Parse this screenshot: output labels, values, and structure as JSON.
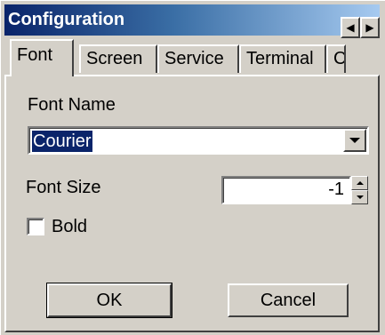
{
  "window": {
    "title": "Configuration"
  },
  "tabs": [
    {
      "label": "Font",
      "active": true
    },
    {
      "label": "Screen",
      "active": false
    },
    {
      "label": "Service",
      "active": false
    },
    {
      "label": "Terminal",
      "active": false
    },
    {
      "label": "C",
      "active": false
    }
  ],
  "tab_scroll": {
    "left_icon": "arrow-left-icon",
    "right_icon": "arrow-right-icon"
  },
  "font_panel": {
    "font_name_label": "Font Name",
    "font_name_value": "Courier",
    "font_size_label": "Font Size",
    "font_size_value": "-1",
    "bold_label": "Bold",
    "bold_checked": false
  },
  "buttons": {
    "ok_label": "OK",
    "cancel_label": "Cancel"
  },
  "colors": {
    "face": "#d4d0c8",
    "title_start": "#0a246a",
    "title_end": "#a6caf0",
    "selection": "#0a246a"
  }
}
